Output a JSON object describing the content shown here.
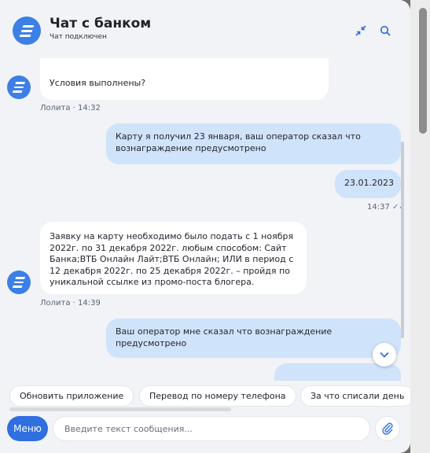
{
  "header": {
    "title": "Чат с банком",
    "status": "Чат подключен",
    "collapse_icon": "collapse-icon",
    "search_icon": "search-icon"
  },
  "messages": [
    {
      "from": "operator",
      "text": "Условия выполнены?",
      "meta": "Лолита · 14:32"
    },
    {
      "from": "user",
      "text": "Карту я получил 23 января, ваш оператор сказал что вознаграждение предусмотрено"
    },
    {
      "from": "user",
      "text": "23.01.2023",
      "meta": "14:37"
    },
    {
      "from": "operator",
      "text": "Заявку на карту необходимо было подать с 1 ноября 2022г. по 31 декабря 2022г. любым способом: Сайт Банка;ВТБ Онлайн Лайт;ВТБ Онлайн; ИЛИ в период с 12 декабря 2022г. по 25 декабря 2022г. – пройдя по уникальной ссылке из промо-поста блогера.",
      "meta": "Лолита · 14:39"
    },
    {
      "from": "user",
      "text": "Ваш оператор мне сказал что вознаграждение предусмотрено"
    }
  ],
  "quick_replies": [
    "Обновить приложение",
    "Перевод по номеру телефона",
    "За что списали день"
  ],
  "composer": {
    "menu_label": "Меню",
    "placeholder": "Введите текст сообщения..."
  },
  "colors": {
    "accent": "#2f6fe0",
    "outgoing_bubble": "#cfe3fb",
    "incoming_bubble": "#ffffff",
    "background": "#f2f3f7"
  }
}
